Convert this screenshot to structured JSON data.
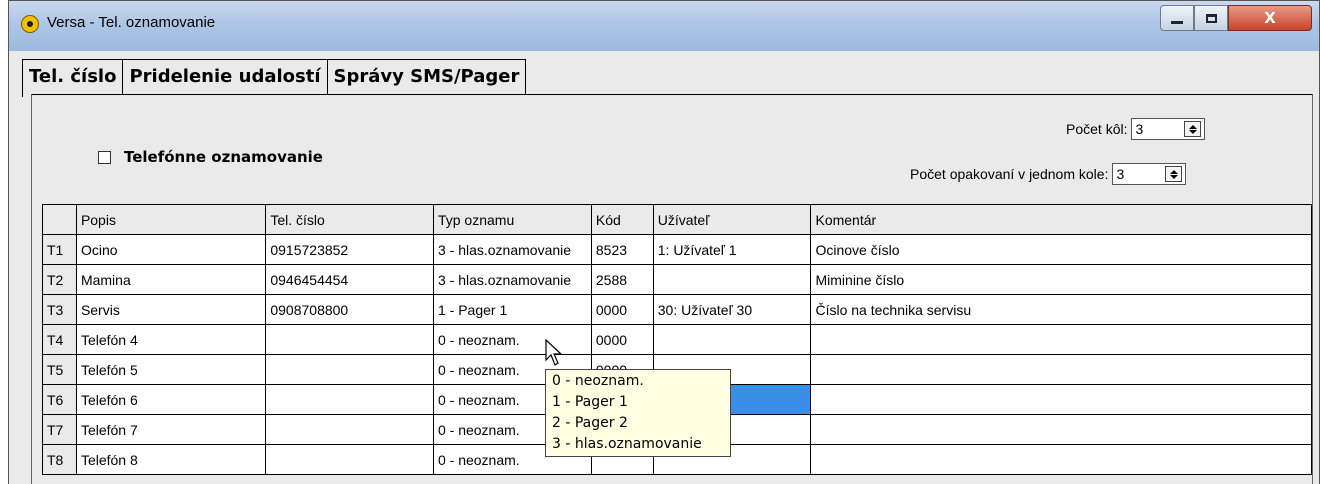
{
  "window": {
    "title": "Versa - Tel. oznamovanie",
    "icon": "app-logo-icon"
  },
  "title_controls": {
    "minimize": "minimize-icon",
    "maximize": "maximize-icon",
    "close_label": "X"
  },
  "tabs": [
    {
      "label": "Tel. číslo",
      "active": true
    },
    {
      "label": "Pridelenie udalostí",
      "active": false
    },
    {
      "label": "Správy SMS/Pager",
      "active": false
    }
  ],
  "notify": {
    "checkbox_label": "Telefónne oznamovanie",
    "checked": false
  },
  "rounds": {
    "label": "Počet kôl:",
    "value": "3"
  },
  "repeats": {
    "label": "Počet opakovaní v jednom kole:",
    "value": "3"
  },
  "table": {
    "columns": [
      "",
      "Popis",
      "Tel. číslo",
      "Typ oznamu",
      "Kód",
      "Užívateľ",
      "Komentár"
    ],
    "rows": [
      [
        "T1",
        "Ocino",
        "0915723852",
        "3 - hlas.oznamovanie",
        "8523",
        "1: Užívateľ  1",
        "Ocinove číslo"
      ],
      [
        "T2",
        "Mamina",
        "0946454454",
        "3 - hlas.oznamovanie",
        "2588",
        "",
        "Miminine číslo"
      ],
      [
        "T3",
        "Servis",
        "0908708800",
        "1 - Pager 1",
        "0000",
        "30: Užívateľ 30",
        "Číslo na technika servisu"
      ],
      [
        "T4",
        "Telefón 4",
        "",
        "0 - neoznam.",
        "0000",
        "",
        ""
      ],
      [
        "T5",
        "Telefón 5",
        "",
        "0 - neoznam.",
        "0000",
        "",
        ""
      ],
      [
        "T6",
        "Telefón 6",
        "",
        "0 - neoznam.",
        "",
        "",
        ""
      ],
      [
        "T7",
        "Telefón 7",
        "",
        "0 - neoznam.",
        "",
        "",
        ""
      ],
      [
        "T8",
        "Telefón 8",
        "",
        "0 - neoznam.",
        "",
        "",
        ""
      ]
    ]
  },
  "dropdown": {
    "options": [
      "0 - neoznam.",
      "1 - Pager 1",
      "2 - Pager 2",
      "3 - hlas.oznamovanie"
    ]
  },
  "colors": {
    "selection": "#3a8ee6",
    "dropdown_bg": "#ffffe3",
    "close_button": "#c8432a"
  }
}
